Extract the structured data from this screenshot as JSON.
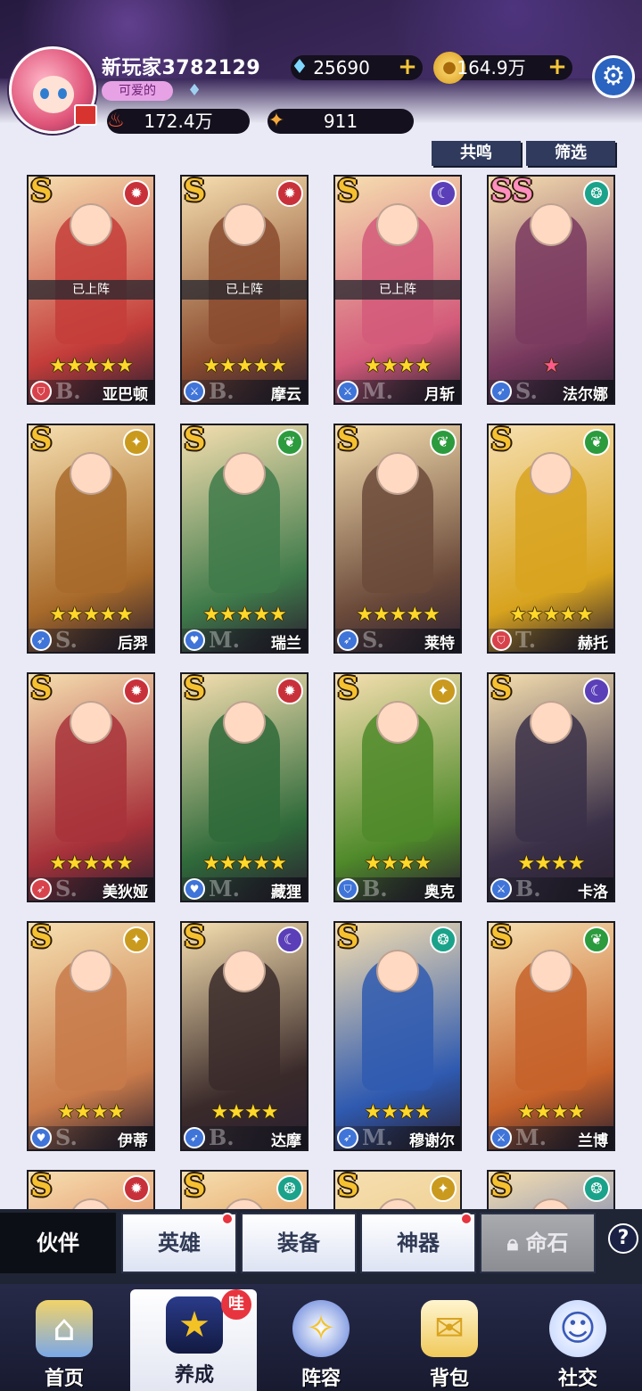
{
  "player": {
    "nickname": "新玩家3782129",
    "title_badge": "可爱的",
    "power": "172.4万",
    "stars": "911"
  },
  "currency": {
    "gems": "25690",
    "gold": "164.9万",
    "plus_symbol": "+"
  },
  "filters": {
    "resonance_label": "共鸣",
    "filter_label": "筛选"
  },
  "deployed_label": "已上阵",
  "heroes": [
    {
      "rank": "S",
      "element": "fire",
      "stars": "★★★★★",
      "role": "shield",
      "grade": "B.",
      "name": "亚巴顿",
      "deployed": true,
      "color": "#c43d3a"
    },
    {
      "rank": "S",
      "element": "fire",
      "stars": "★★★★★",
      "role": "sword",
      "grade": "B.",
      "name": "摩云",
      "deployed": true,
      "color": "#8a4b2e"
    },
    {
      "rank": "S",
      "element": "moon",
      "stars": "★★★★",
      "role": "sword",
      "grade": "M.",
      "name": "月斩",
      "deployed": true,
      "color": "#d35a7a"
    },
    {
      "rank": "SS",
      "element": "wind",
      "stars": "★",
      "role": "bow",
      "grade": "S.",
      "name": "法尔娜",
      "deployed": false,
      "color": "#7a3a5f"
    },
    {
      "rank": "S",
      "element": "light",
      "stars": "★★★★★",
      "role": "bow",
      "grade": "S.",
      "name": "后羿",
      "deployed": false,
      "color": "#a86a2a"
    },
    {
      "rank": "S",
      "element": "leaf",
      "stars": "★★★★★",
      "role": "heart",
      "grade": "M.",
      "name": "瑞兰",
      "deployed": false,
      "color": "#3f7a4a"
    },
    {
      "rank": "S",
      "element": "leaf",
      "stars": "★★★★★",
      "role": "bow",
      "grade": "S.",
      "name": "莱特",
      "deployed": false,
      "color": "#6b4a3a"
    },
    {
      "rank": "S",
      "element": "leaf",
      "stars": "★★★★★",
      "role": "shield",
      "grade": "T.",
      "name": "赫托",
      "deployed": false,
      "color": "#d8a31e"
    },
    {
      "rank": "S",
      "element": "fire",
      "stars": "★★★★★",
      "role": "bow",
      "grade": "S.",
      "name": "美狄娅",
      "deployed": false,
      "color": "#a8323a"
    },
    {
      "rank": "S",
      "element": "fire",
      "stars": "★★★★★",
      "role": "heart",
      "grade": "M.",
      "name": "藏狸",
      "deployed": false,
      "color": "#2f6a3a"
    },
    {
      "rank": "S",
      "element": "light",
      "stars": "★★★★",
      "role": "shield",
      "grade": "B.",
      "name": "奥克",
      "deployed": false,
      "color": "#4f8a2a"
    },
    {
      "rank": "S",
      "element": "moon",
      "stars": "★★★★",
      "role": "sword",
      "grade": "B.",
      "name": "卡洛",
      "deployed": false,
      "color": "#3a3048"
    },
    {
      "rank": "S",
      "element": "light",
      "stars": "★★★★",
      "role": "heart",
      "grade": "S.",
      "name": "伊蒂",
      "deployed": false,
      "color": "#c87a4a"
    },
    {
      "rank": "S",
      "element": "moon",
      "stars": "★★★★",
      "role": "bow",
      "grade": "B.",
      "name": "达摩",
      "deployed": false,
      "color": "#3a2a2a"
    },
    {
      "rank": "S",
      "element": "wind",
      "stars": "★★★★",
      "role": "bow",
      "grade": "M.",
      "name": "穆谢尔",
      "deployed": false,
      "color": "#2f5ab0"
    },
    {
      "rank": "S",
      "element": "leaf",
      "stars": "★★★★",
      "role": "sword",
      "grade": "M.",
      "name": "兰博",
      "deployed": false,
      "color": "#c6622a"
    },
    {
      "rank": "S",
      "element": "fire",
      "stars": "",
      "role": "",
      "grade": "",
      "name": "",
      "deployed": false,
      "color": "#d8603a"
    },
    {
      "rank": "S",
      "element": "wind",
      "stars": "",
      "role": "",
      "grade": "",
      "name": "",
      "deployed": false,
      "color": "#d8742a"
    },
    {
      "rank": "S",
      "element": "light",
      "stars": "",
      "role": "",
      "grade": "",
      "name": "",
      "deployed": false,
      "color": "#e9c27a"
    },
    {
      "rank": "S",
      "element": "wind",
      "stars": "",
      "role": "",
      "grade": "",
      "name": "",
      "deployed": false,
      "color": "#3a5ab8"
    }
  ],
  "subtabs": {
    "partner": "伙伴",
    "hero": "英雄",
    "equipment": "装备",
    "artifact": "神器",
    "fate_stone": "命石",
    "help": "?"
  },
  "bottomnav": {
    "home": "首页",
    "develop": "养成",
    "develop_badge": "哇",
    "lineup": "阵容",
    "bag": "背包",
    "social": "社交"
  },
  "colors": {
    "accent_gold": "#f5c73a",
    "badge_red": "#e8343e",
    "nav_dark": "#181a30"
  }
}
